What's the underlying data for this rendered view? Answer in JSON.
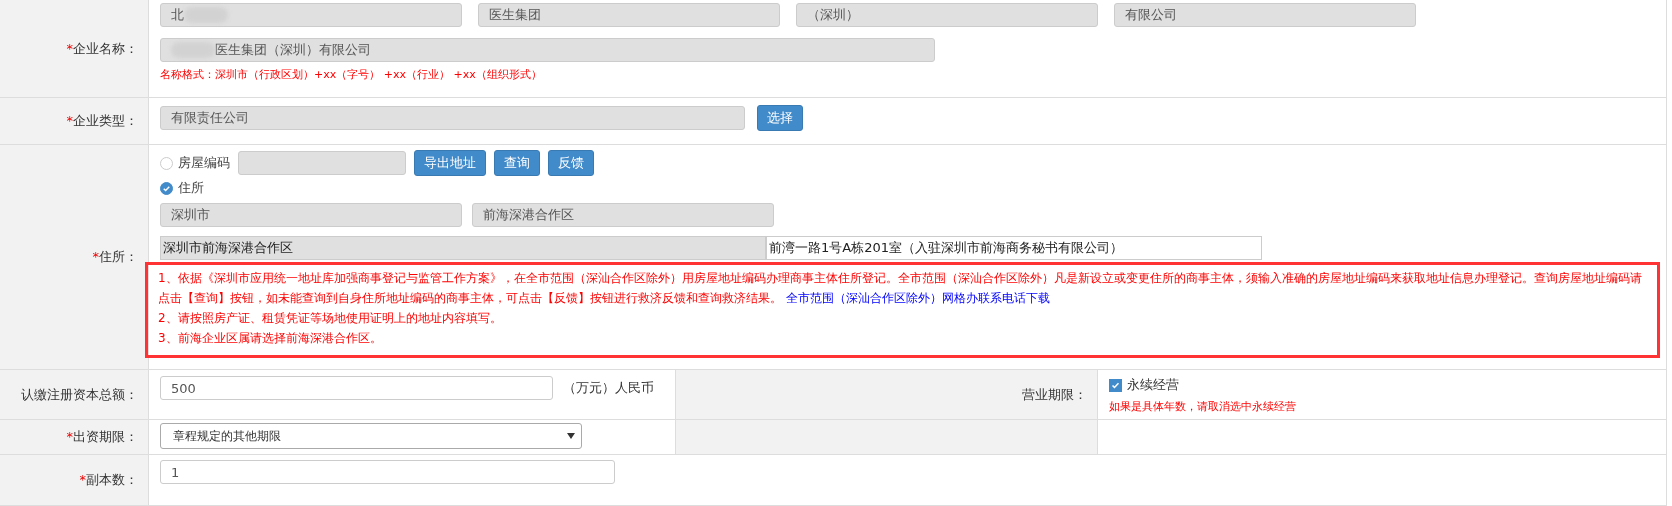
{
  "company_name": {
    "mark": "*",
    "label": "企业名称：",
    "parts": [
      {
        "value": "北",
        "redacted_after": true
      },
      {
        "value": "医生集团"
      },
      {
        "value": "（深圳）"
      },
      {
        "value": "有限公司"
      }
    ],
    "full_name": {
      "value": "医生集团（深圳）有限公司",
      "redacted_before": true
    },
    "hint": "名称格式：深圳市（行政区划）+xx（字号） +xx（行业） +xx（组织形式）"
  },
  "company_type": {
    "mark": "*",
    "label": "企业类型：",
    "value": "有限责任公司",
    "button": "选择"
  },
  "address": {
    "mark": "*",
    "label": "住所：",
    "options": [
      {
        "label": "房屋编码",
        "selected": false
      },
      {
        "label": "住所",
        "selected": true
      }
    ],
    "buttons": [
      "导出地址",
      "查询",
      "反馈"
    ],
    "districts": [
      {
        "value": "深圳市"
      },
      {
        "value": "前海深港合作区"
      }
    ],
    "address_fields": [
      {
        "value": "深圳市前海深港合作区",
        "disabled": true
      },
      {
        "value": "前湾一路1号A栋201室（入驻深圳市前海商务秘书有限公司）",
        "disabled": false
      }
    ],
    "notes": [
      {
        "text": "1、依据《深圳市应用统一地址库加强商事登记与监管工作方案》，在全市范围（深汕合作区除外）用房屋地址编码办理商事主体住所登记。全市范围（深汕合作区除外）凡是新设立或变更住所的商事主体，须输入准确的房屋地址编码来获取地址信息办理登记。查询房屋地址编码请点击【查询】按钮，如未能查询到自身住所地址编码的商事主体，可点击【反馈】按钮进行救济反馈和查询救济结果。",
        "link": "全市范围（深汕合作区除外）网格办联系电话下载"
      },
      {
        "text": "2、请按照房产证、租赁凭证等场地使用证明上的地址内容填写。"
      },
      {
        "text": "3、前海企业区属请选择前海深港合作区。"
      }
    ]
  },
  "capital": {
    "label": "认缴注册资本总额：",
    "value": "500",
    "unit": "（万元）人民币"
  },
  "term": {
    "label": "营业期限：",
    "checkbox": {
      "label": "永续经营",
      "checked": true
    },
    "hint": "如果是具体年数，请取消选中永续经营"
  },
  "investment_period": {
    "mark": "*",
    "label": "出资期限：",
    "value": "章程规定的其他期限"
  },
  "copies": {
    "mark": "*",
    "label": "副本数：",
    "value": "1"
  }
}
